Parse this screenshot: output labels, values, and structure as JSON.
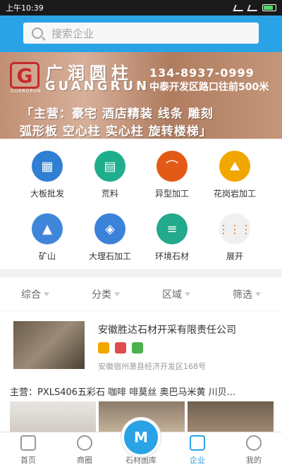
{
  "status": {
    "left_text": "上午10:39"
  },
  "search": {
    "placeholder": "搜索企业"
  },
  "banner": {
    "brand_cn": "广润圆柱",
    "brand_en": "GUANGRUN",
    "brand_tag": "GUANGRUN",
    "phone": "134-8937-0999",
    "address": "中泰开发区路口往前500米",
    "line1": "「主营：豪宅  酒店精装  线条  雕刻",
    "line2": "弧形板  空心柱  实心柱  旋转楼梯」"
  },
  "categories": [
    {
      "label": "大板批发",
      "icon": "slab-icon",
      "color": "#2f7fd3"
    },
    {
      "label": "荒料",
      "icon": "bricks-icon",
      "color": "#1eae8c"
    },
    {
      "label": "异型加工",
      "icon": "arch-icon",
      "color": "#e35a17"
    },
    {
      "label": "花岗岩加工",
      "icon": "mountain-stone-icon",
      "color": "#f2a600"
    },
    {
      "label": "矿山",
      "icon": "mine-icon",
      "color": "#3f86db"
    },
    {
      "label": "大理石加工",
      "icon": "layers-icon",
      "color": "#3b82d9"
    },
    {
      "label": "环境石材",
      "icon": "stack-icon",
      "color": "#23a98c"
    },
    {
      "label": "展开",
      "icon": "expand-grid-icon",
      "color": "#f0f0f0"
    }
  ],
  "filters": [
    {
      "label": "综合"
    },
    {
      "label": "分类"
    },
    {
      "label": "区域"
    },
    {
      "label": "筛选"
    }
  ],
  "listing": {
    "company": "安徽胜达石材开采有限责任公司",
    "address": "安徽宿州萧县经济开发区168号"
  },
  "main_business": {
    "text": "主营：PXLS406五彩石  咖啡  啡莫丝  奥巴马米黄  川贝..."
  },
  "tabbar": [
    {
      "label": "首页",
      "icon": "home-icon",
      "active": false
    },
    {
      "label": "商圈",
      "icon": "radar-icon",
      "active": false
    },
    {
      "label": "石材图库",
      "icon": "gallery-logo-icon",
      "active": false
    },
    {
      "label": "企业",
      "icon": "building-icon",
      "active": true
    },
    {
      "label": "我的",
      "icon": "user-icon",
      "active": false
    }
  ],
  "colors": {
    "accent": "#2aa3e6"
  }
}
